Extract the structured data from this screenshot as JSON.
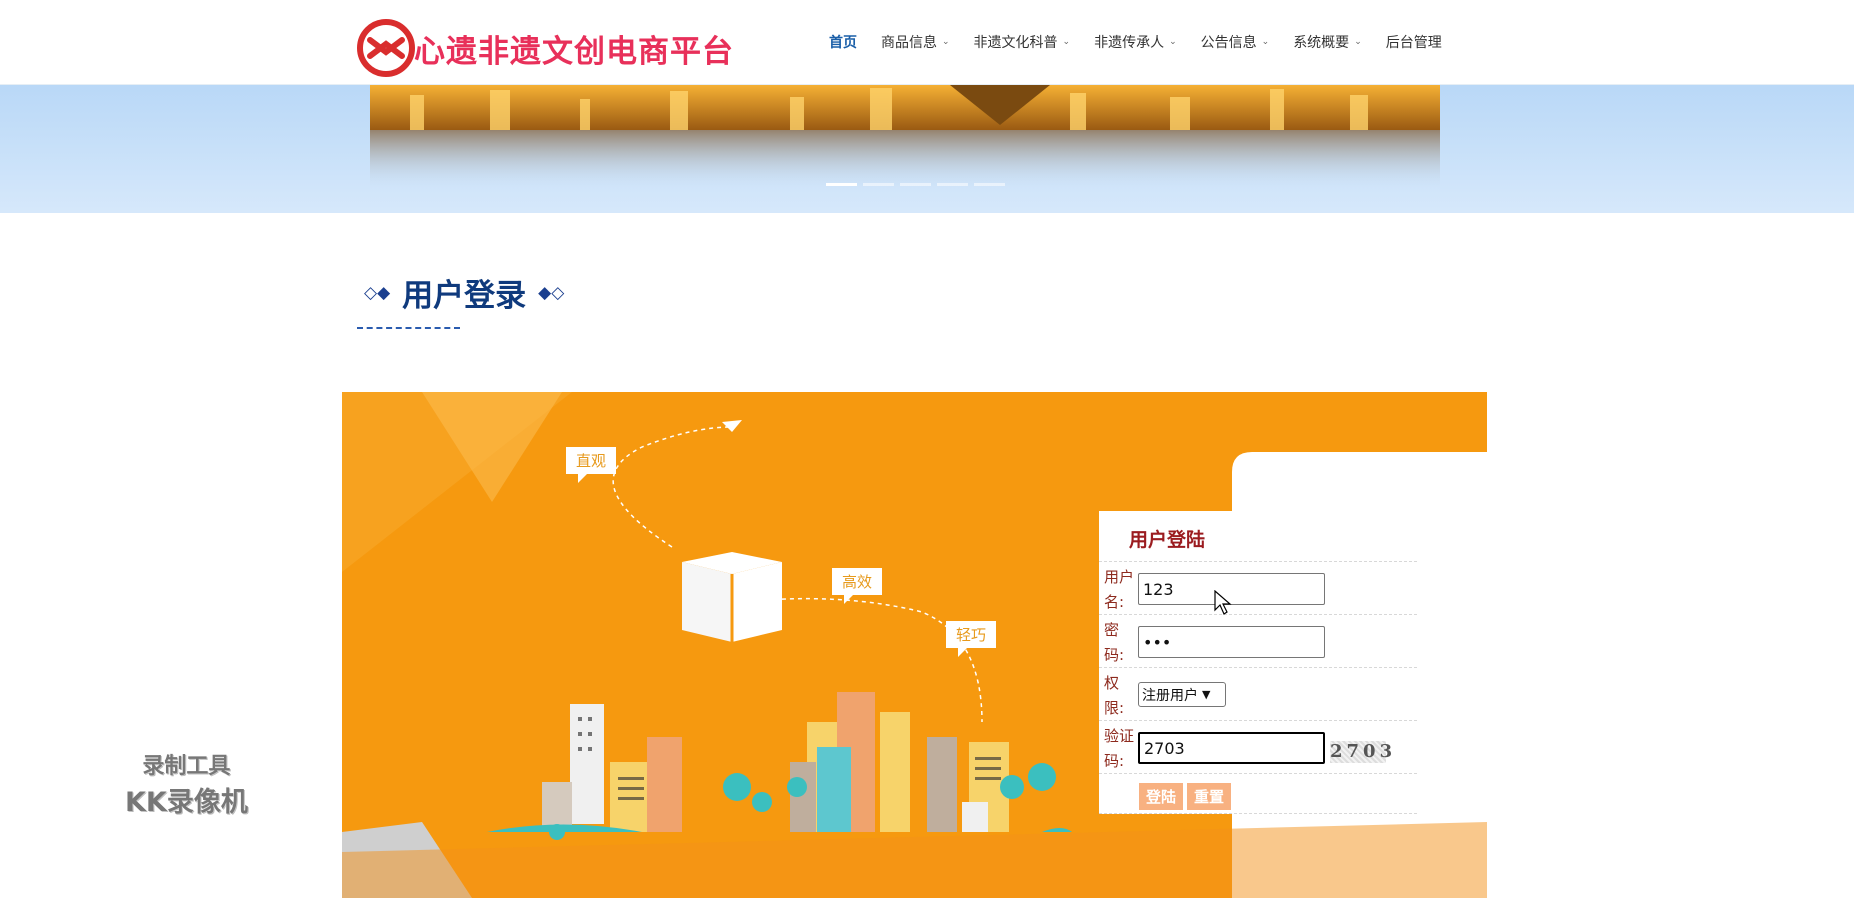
{
  "header": {
    "site_title": "心遗非遗文创电商平台",
    "nav": [
      {
        "label": "首页",
        "active": true,
        "has_caret": false
      },
      {
        "label": "商品信息",
        "has_caret": true
      },
      {
        "label": "非遗文化科普",
        "has_caret": true
      },
      {
        "label": "非遗传承人",
        "has_caret": true
      },
      {
        "label": "公告信息",
        "has_caret": true
      },
      {
        "label": "系统概要",
        "has_caret": true
      },
      {
        "label": "后台管理",
        "has_caret": false
      }
    ],
    "caret_icon": "chevron-down-icon"
  },
  "banner": {
    "slides": 5,
    "active_slide": 1
  },
  "section": {
    "deco_left": "◇◆",
    "title": "用户登录",
    "deco_right": "◆◇"
  },
  "panel": {
    "bubbles": [
      "直观",
      "高效",
      "轻巧"
    ],
    "color": "#f6990f"
  },
  "login": {
    "title": "用户登陆",
    "username_label": "用户名:",
    "username_value": "123",
    "password_label": "密码:",
    "password_value": "•••",
    "role_label": "权限:",
    "role_value": "注册用户",
    "captcha_label": "验证码:",
    "captcha_input": "2703",
    "captcha_image_text": "2703",
    "login_button": "登陆",
    "reset_button": "重置"
  },
  "watermark": {
    "line1": "录制工具",
    "line2": "KK录像机"
  }
}
